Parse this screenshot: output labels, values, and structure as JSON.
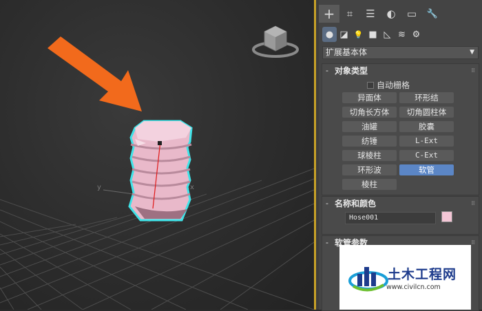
{
  "command_panel": {
    "tabs": [
      {
        "name": "create",
        "glyph": "+"
      },
      {
        "name": "modify",
        "glyph": "⌗"
      },
      {
        "name": "hierarchy",
        "glyph": "☰"
      },
      {
        "name": "motion",
        "glyph": "◐"
      },
      {
        "name": "display",
        "glyph": "▭"
      },
      {
        "name": "utilities",
        "glyph": "🔧"
      }
    ],
    "subtabs": [
      {
        "name": "geometry",
        "glyph": "●"
      },
      {
        "name": "shapes",
        "glyph": "◪"
      },
      {
        "name": "lights",
        "glyph": "💡"
      },
      {
        "name": "cameras",
        "glyph": "■"
      },
      {
        "name": "helpers",
        "glyph": "◺"
      },
      {
        "name": "space-warps",
        "glyph": "≋"
      },
      {
        "name": "systems",
        "glyph": "⚙"
      }
    ],
    "category_dropdown": "扩展基本体",
    "object_type": {
      "title": "对象类型",
      "sign": "-",
      "auto_grid": "自动栅格",
      "buttons": [
        "异面体",
        "环形结",
        "切角长方体",
        "切角圆柱体",
        "油罐",
        "胶囊",
        "纺锤",
        "L-Ext",
        "球棱柱",
        "C-Ext",
        "环形波",
        "软管",
        "棱柱"
      ],
      "active_button": "软管"
    },
    "name_color": {
      "title": "名称和颜色",
      "sign": "-",
      "name_value": "Hose001",
      "color": "#f4c6d6"
    },
    "hose_params": {
      "title": "软管参数",
      "sign": "-"
    }
  },
  "viewport": {
    "axis_x": "x",
    "axis_y": "y",
    "object_color": "#e8b7c8",
    "selection_color": "#3fe3e8",
    "arrow_color": "#f26a1c"
  },
  "watermark": {
    "text": "土木工程网",
    "url": "www.civilcn.com"
  }
}
